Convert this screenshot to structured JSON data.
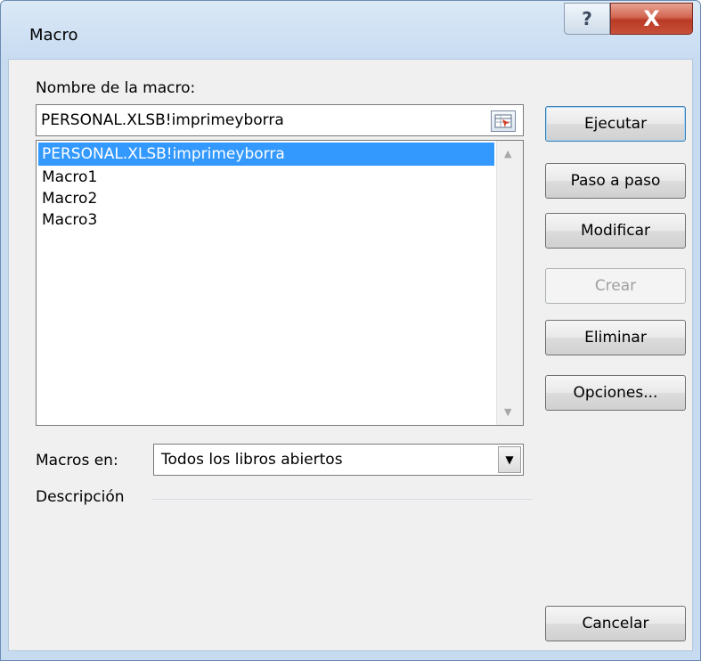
{
  "window": {
    "title": "Macro",
    "help_glyph": "?",
    "close_glyph": "X"
  },
  "form": {
    "macro_name_label": "Nombre de la macro:",
    "macro_name_value": "PERSONAL.XLSB!imprimeyborra",
    "macros": [
      {
        "name": "PERSONAL.XLSB!imprimeyborra",
        "selected": true
      },
      {
        "name": "Macro1",
        "selected": false
      },
      {
        "name": "Macro2",
        "selected": false
      },
      {
        "name": "Macro3",
        "selected": false
      }
    ],
    "macros_in_label": "Macros en:",
    "macros_in_value": "Todos los libros abiertos",
    "description_label": "Descripción"
  },
  "buttons": {
    "run": "Ejecutar",
    "step": "Paso a paso",
    "edit": "Modificar",
    "create": "Crear",
    "delete": "Eliminar",
    "options": "Opciones...",
    "cancel": "Cancelar"
  },
  "colors": {
    "selection": "#3399ff",
    "close_button": "#c9503a"
  }
}
